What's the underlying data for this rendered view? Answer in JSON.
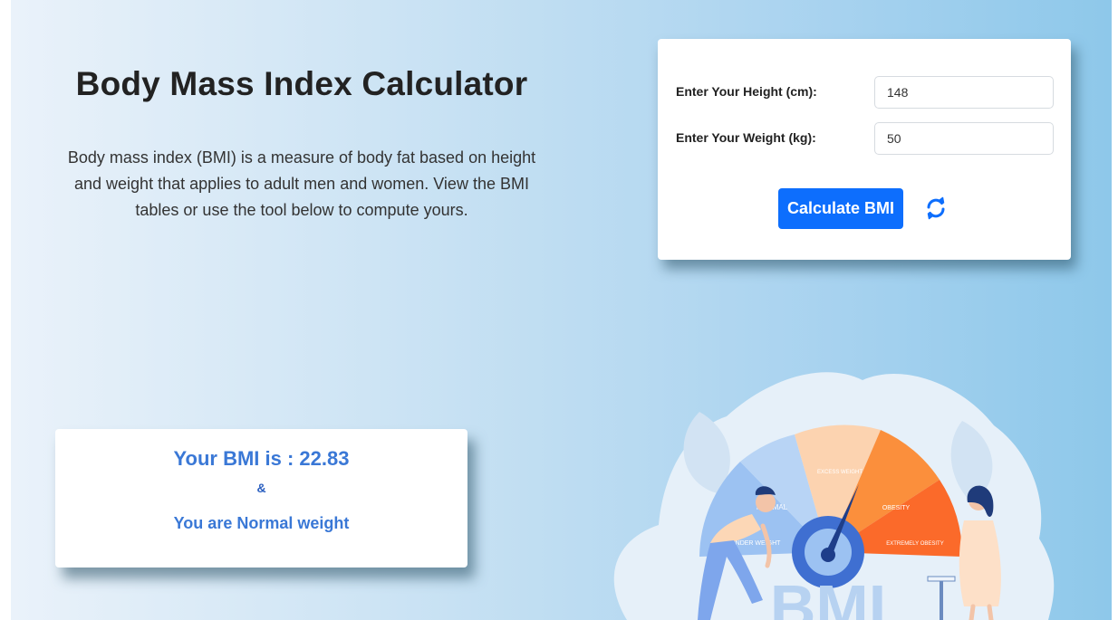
{
  "header": {
    "title": "Body Mass Index Calculator",
    "description": "Body mass index (BMI) is a measure of body fat based on height and weight that applies to adult men and women. View the BMI tables or use the tool below to compute yours."
  },
  "form": {
    "height_label": "Enter Your Height (cm):",
    "height_value": "148",
    "weight_label": "Enter Your Weight (kg):",
    "weight_value": "50",
    "calculate_label": "Calculate BMI",
    "reset_icon": "refresh-icon"
  },
  "result": {
    "bmi_text": "Your BMI is : 22.83",
    "separator": "&",
    "status_text": "You are Normal weight"
  },
  "illustration": {
    "segments": [
      "NORMAL",
      "UNDER WEIGHT",
      "EXCESS WEIGHT",
      "OBESITY",
      "EXTREMELY OBESITY"
    ],
    "logo_text": "BMI"
  },
  "colors": {
    "accent": "#0d6efd",
    "result_text": "#3a78d6",
    "background_start": "#eaf2fa",
    "background_end": "#8ec8ea"
  }
}
